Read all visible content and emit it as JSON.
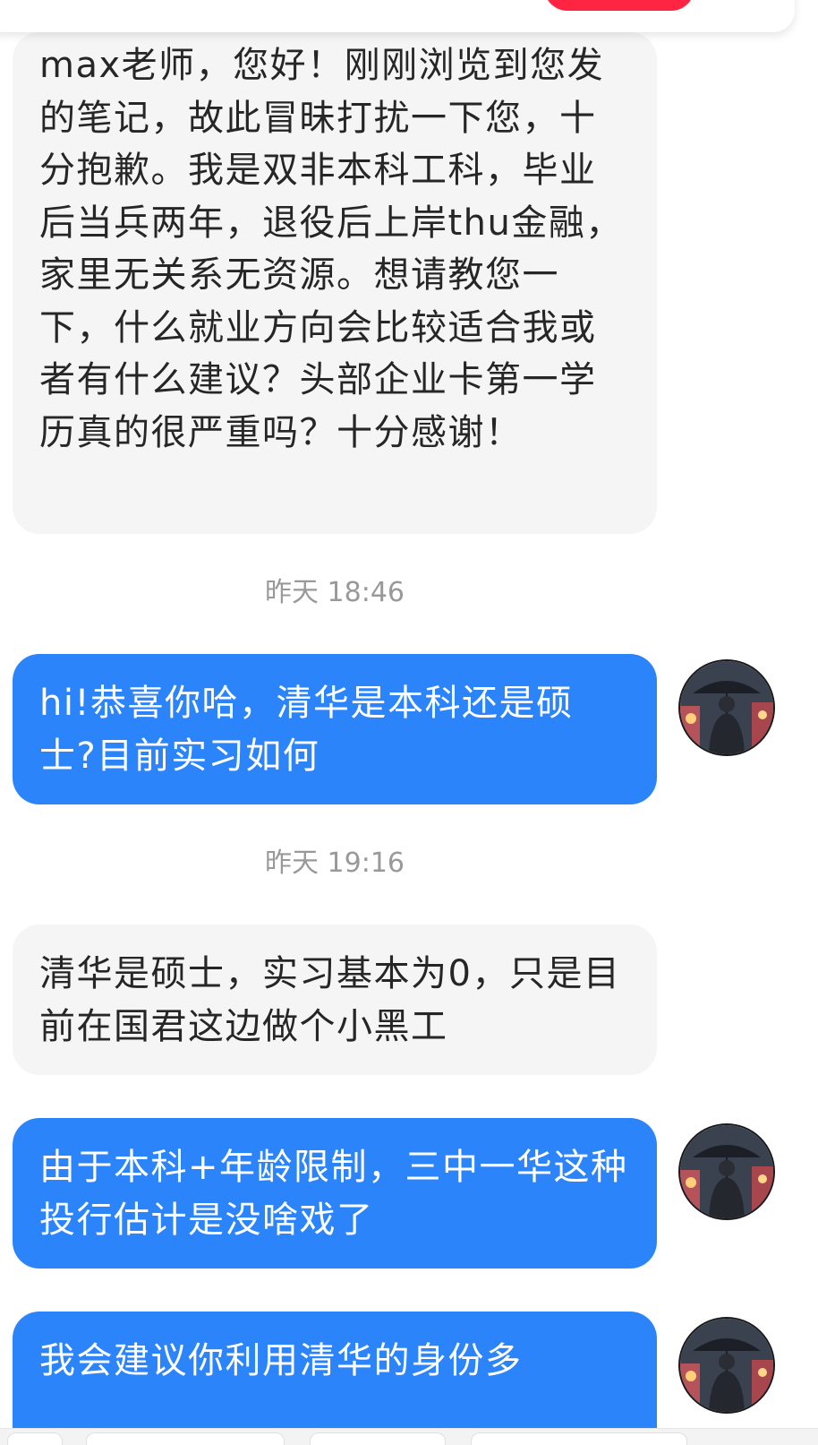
{
  "messages": [
    {
      "id": "msg-1",
      "direction": "received",
      "text": "max老师，您好！刚刚浏览到您发的笔记，故此冒昧打扰一下您，十分抱歉。我是双非本科工科，毕业后当兵两年，退役后上岸thu金融，家里无关系无资源。想请教您一下，什么就业方向会比较适合我或者有什么建议？头部企业卡第一学历真的很严重吗？十分感谢！"
    },
    {
      "id": "ts-1",
      "timestamp": "昨天 18:46"
    },
    {
      "id": "msg-2",
      "direction": "sent",
      "text": "hi!恭喜你哈，清华是本科还是硕士?目前实习如何"
    },
    {
      "id": "ts-2",
      "timestamp": "昨天 19:16"
    },
    {
      "id": "msg-3",
      "direction": "received",
      "text": "清华是硕士，实习基本为0，只是目前在国君这边做个小黑工"
    },
    {
      "id": "msg-4",
      "direction": "sent",
      "text": "由于本科+年龄限制，三中一华这种投行估计是没啥戏了"
    },
    {
      "id": "msg-5",
      "direction": "sent",
      "text": "我会建议你利用清华的身份多"
    }
  ],
  "avatar_icon": "user-avatar-umbrella-man",
  "colors": {
    "sent_bubble": "#2b84fa",
    "received_bubble": "#f5f5f5",
    "timestamp_text": "#999999",
    "accent_red": "#ff2442"
  }
}
